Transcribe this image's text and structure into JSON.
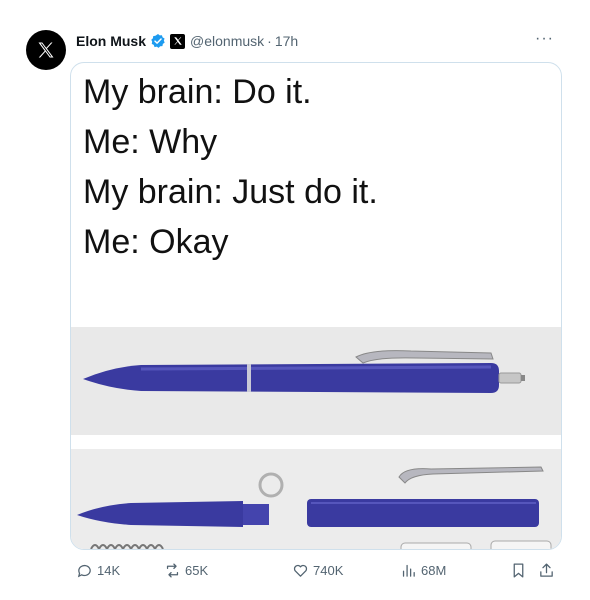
{
  "author": {
    "name": "Elon Musk",
    "handle": "@elonmusk",
    "separator": "·",
    "time": "17h"
  },
  "more_label": "···",
  "meme": {
    "lines": [
      "My brain: Do it.",
      "Me: Why",
      "My brain: Just do it.",
      "Me: Okay"
    ]
  },
  "actions": {
    "replies": "14K",
    "reposts": "65K",
    "likes": "740K",
    "views": "68M"
  },
  "colors": {
    "verified": "#1d9bf0",
    "muted": "#536471",
    "pen_body": "#3a3aa0"
  },
  "icons": [
    "x-logo-icon",
    "verified-badge-icon",
    "affiliate-x-icon",
    "reply-icon",
    "repost-icon",
    "like-icon",
    "views-icon",
    "bookmark-icon",
    "share-icon"
  ]
}
